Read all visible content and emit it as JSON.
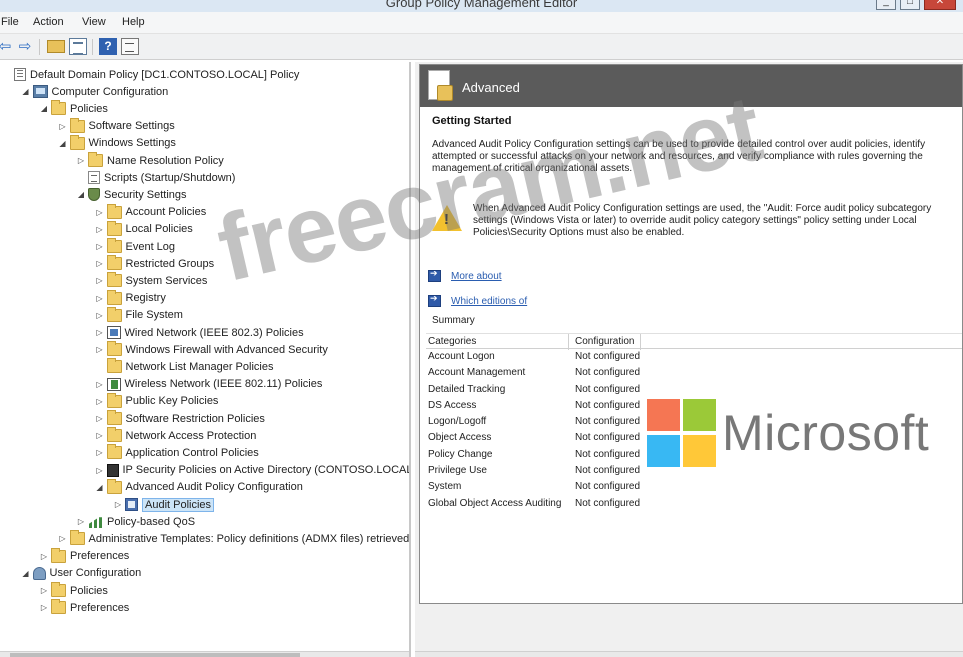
{
  "window": {
    "title": "Group Policy Management Editor",
    "minimize": "_",
    "maximize": "□",
    "close": "✕"
  },
  "menu": {
    "items": [
      "File",
      "Action",
      "View",
      "Help"
    ]
  },
  "toolbar": {
    "back": "⇦",
    "forward": "⇨",
    "help": "?"
  },
  "tree": {
    "items": [
      {
        "label": "Default Domain Policy [DC1.CONTOSO.LOCAL] Policy",
        "indent": 0,
        "icon": "policy",
        "expander": ""
      },
      {
        "label": "Computer Configuration",
        "indent": 1,
        "icon": "computer",
        "expander": "◢"
      },
      {
        "label": "Policies",
        "indent": 2,
        "icon": "folder",
        "expander": "◢"
      },
      {
        "label": "Software Settings",
        "indent": 3,
        "icon": "folder",
        "expander": "▷"
      },
      {
        "label": "Windows Settings",
        "indent": 3,
        "icon": "folder",
        "expander": "◢"
      },
      {
        "label": "Name Resolution Policy",
        "indent": 4,
        "icon": "folder",
        "expander": "▷"
      },
      {
        "label": "Scripts (Startup/Shutdown)",
        "indent": 4,
        "icon": "doc",
        "expander": ""
      },
      {
        "label": "Security Settings",
        "indent": 4,
        "icon": "shield",
        "expander": "◢"
      },
      {
        "label": "Account Policies",
        "indent": 5,
        "icon": "folder",
        "expander": "▷"
      },
      {
        "label": "Local Policies",
        "indent": 5,
        "icon": "folder",
        "expander": "▷"
      },
      {
        "label": "Event Log",
        "indent": 5,
        "icon": "folder",
        "expander": "▷"
      },
      {
        "label": "Restricted Groups",
        "indent": 5,
        "icon": "folder",
        "expander": "▷"
      },
      {
        "label": "System Services",
        "indent": 5,
        "icon": "folder",
        "expander": "▷"
      },
      {
        "label": "Registry",
        "indent": 5,
        "icon": "folder",
        "expander": "▷"
      },
      {
        "label": "File System",
        "indent": 5,
        "icon": "folder",
        "expander": "▷"
      },
      {
        "label": "Wired Network (IEEE 802.3) Policies",
        "indent": 5,
        "icon": "network",
        "expander": "▷"
      },
      {
        "label": "Windows Firewall with Advanced Security",
        "indent": 5,
        "icon": "folder",
        "expander": "▷"
      },
      {
        "label": "Network List Manager Policies",
        "indent": 5,
        "icon": "folder",
        "expander": ""
      },
      {
        "label": "Wireless Network (IEEE 802.11) Policies",
        "indent": 5,
        "icon": "wireless",
        "expander": "▷"
      },
      {
        "label": "Public Key Policies",
        "indent": 5,
        "icon": "folder",
        "expander": "▷"
      },
      {
        "label": "Software Restriction Policies",
        "indent": 5,
        "icon": "folder",
        "expander": "▷"
      },
      {
        "label": "Network Access Protection",
        "indent": 5,
        "icon": "folder",
        "expander": "▷"
      },
      {
        "label": "Application Control Policies",
        "indent": 5,
        "icon": "folder",
        "expander": "▷"
      },
      {
        "label": "IP Security Policies on Active Directory (CONTOSO.LOCAL)",
        "indent": 5,
        "icon": "ipsec",
        "expander": "▷"
      },
      {
        "label": "Advanced Audit Policy Configuration",
        "indent": 5,
        "icon": "folder",
        "expander": "◢"
      },
      {
        "label": "Audit Policies",
        "indent": 6,
        "icon": "audit",
        "expander": "▷",
        "selected": true
      },
      {
        "label": "Policy-based QoS",
        "indent": 4,
        "icon": "qos",
        "expander": "▷"
      },
      {
        "label": "Administrative Templates: Policy definitions (ADMX files) retrieved",
        "indent": 3,
        "icon": "folder",
        "expander": "▷"
      },
      {
        "label": "Preferences",
        "indent": 2,
        "icon": "folder",
        "expander": "▷"
      },
      {
        "label": "User Configuration",
        "indent": 1,
        "icon": "user",
        "expander": "◢"
      },
      {
        "label": "Policies",
        "indent": 2,
        "icon": "folder",
        "expander": "▷"
      },
      {
        "label": "Preferences",
        "indent": 2,
        "icon": "folder",
        "expander": "▷"
      }
    ]
  },
  "details": {
    "header_title": "Advanced",
    "getting_started_title": "Getting Started",
    "getting_started_text": "Advanced Audit Policy Configuration settings can be used to provide detailed control over audit policies, identify attempted or successful attacks on your network and resources, and verify compliance with rules governing the management of critical organizational assets.",
    "warning_text": "When Advanced Audit Policy Configuration settings are used, the \"Audit: Force audit policy subcategory settings (Windows Vista or later) to override audit policy category settings\" policy setting under Local Policies\\Security Options must also be enabled.",
    "links": [
      "More about",
      "Which editions of"
    ],
    "summary_label": "Summary",
    "columns": [
      "Categories",
      "Configuration"
    ],
    "rows": [
      {
        "category": "Account Logon",
        "config": "Not configured"
      },
      {
        "category": "Account Management",
        "config": "Not configured"
      },
      {
        "category": "Detailed Tracking",
        "config": "Not configured"
      },
      {
        "category": "DS Access",
        "config": "Not configured"
      },
      {
        "category": "Logon/Logoff",
        "config": "Not configured"
      },
      {
        "category": "Object Access",
        "config": "Not configured"
      },
      {
        "category": "Policy Change",
        "config": "Not configured"
      },
      {
        "category": "Privilege Use",
        "config": "Not configured"
      },
      {
        "category": "System",
        "config": "Not configured"
      },
      {
        "category": "Global Object Access Auditing",
        "config": "Not configured"
      }
    ]
  },
  "watermarks": {
    "freecram": "freecram.net",
    "microsoft": "Microsoft"
  },
  "colors": {
    "selection": "#cce4f7",
    "header_bg": "#5b5b5b",
    "link": "#2a5db0",
    "warning": "#f2c12e"
  }
}
